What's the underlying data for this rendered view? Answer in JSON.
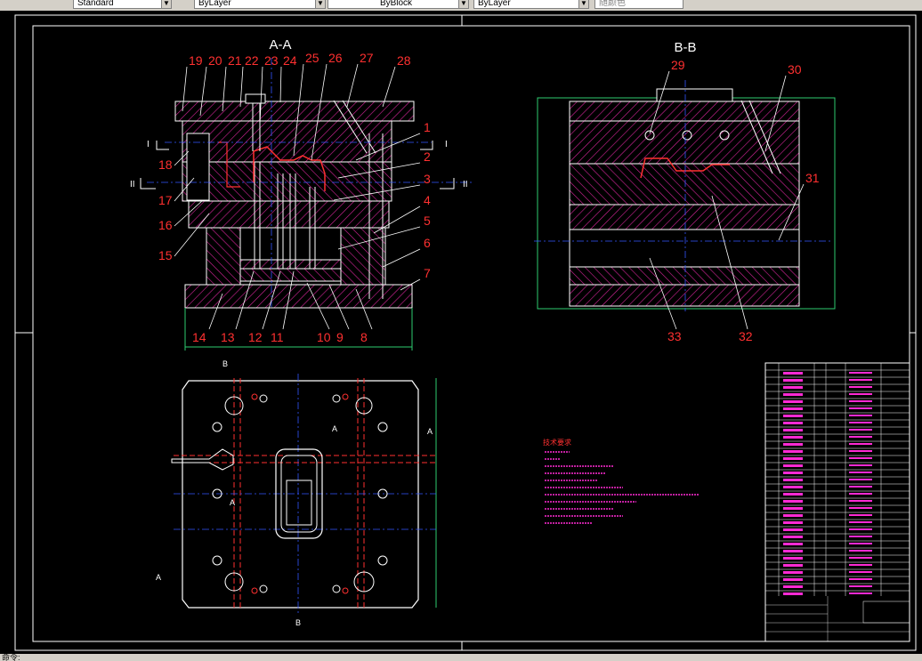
{
  "toolbar": {
    "textstyle": "Standard",
    "layer": "ByLayer",
    "linetype": "ByBlock",
    "lineweight": "ByLayer",
    "plotstyle": "随颜色"
  },
  "drawing": {
    "section_aa": "A-A",
    "section_bb": "B-B",
    "callouts_top": [
      "19",
      "20",
      "21",
      "22",
      "23",
      "24",
      "25",
      "26",
      "27",
      "28"
    ],
    "callouts_right": [
      "1",
      "2",
      "3",
      "4",
      "5",
      "6",
      "7"
    ],
    "callouts_left": [
      "18",
      "17",
      "16",
      "15"
    ],
    "callouts_bottom": [
      "14",
      "13",
      "12",
      "11",
      "10",
      "9",
      "8"
    ],
    "callouts_bb": [
      "29",
      "30",
      "31",
      "33",
      "32"
    ],
    "section_marks": [
      "I",
      "I",
      "II",
      "II",
      "B",
      "B",
      "A",
      "A",
      "A",
      "A"
    ],
    "notes_title": "技术要求"
  },
  "status": {
    "text": "命令:"
  }
}
